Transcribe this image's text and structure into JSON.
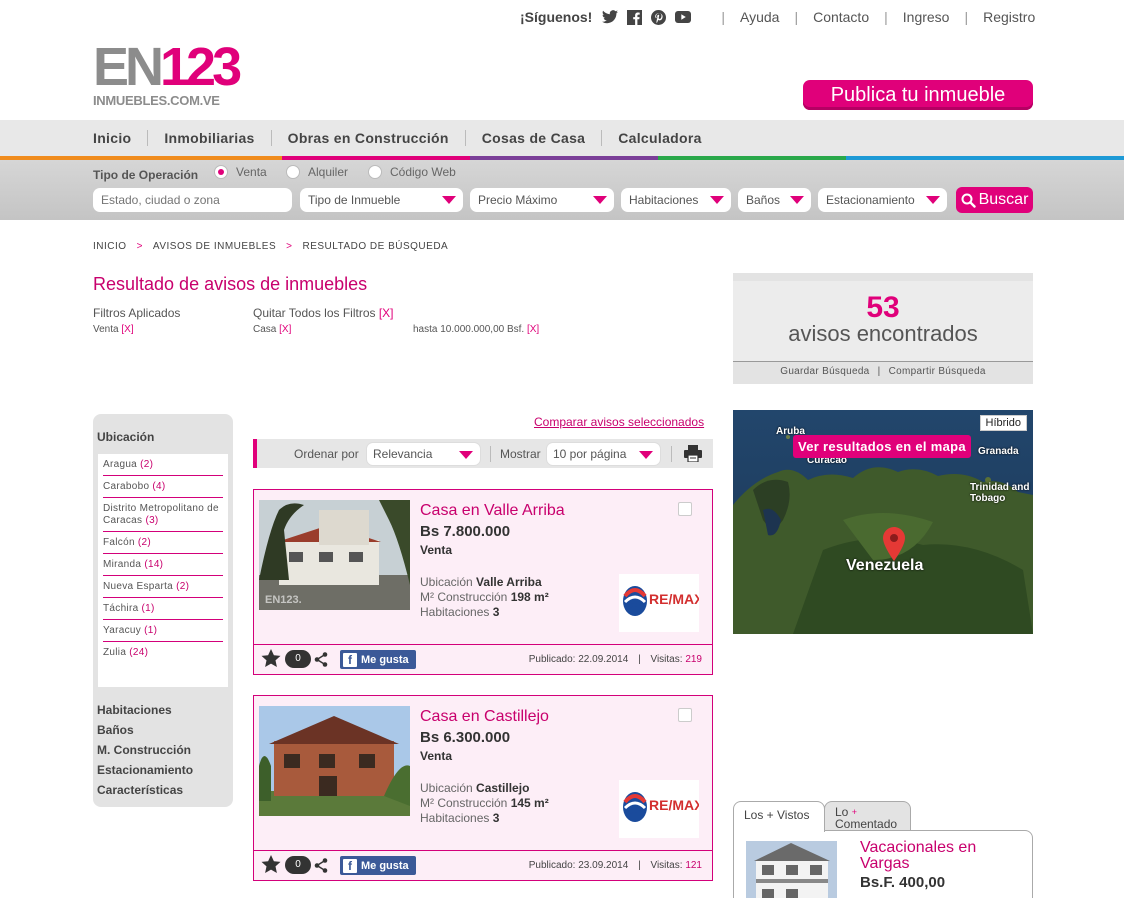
{
  "top": {
    "follow_label": "¡Síguenos!",
    "links": [
      "Ayuda",
      "Contacto",
      "Ingreso",
      "Registro"
    ]
  },
  "logo": {
    "main_en": "EN",
    "main_num": "123",
    "sub": "INMUEBLES.COM.VE"
  },
  "publish_button": "Publica tu inmueble",
  "nav": [
    "Inicio",
    "Inmobiliarias",
    "Obras en Construcción",
    "Cosas de Casa",
    "Calculadora"
  ],
  "colors": {
    "accent": "#e0007a",
    "stripe": [
      "#f08c1e",
      "#e0007a",
      "#7b3f98",
      "#29a84a",
      "#1e9ad6"
    ]
  },
  "search": {
    "operation_label": "Tipo de Operación",
    "operations": [
      {
        "label": "Venta",
        "selected": true
      },
      {
        "label": "Alquiler",
        "selected": false
      },
      {
        "label": "Código Web",
        "selected": false
      }
    ],
    "location_placeholder": "Estado, ciudad o zona",
    "selects": [
      "Tipo de Inmueble",
      "Precio Máximo",
      "Habitaciones",
      "Baños",
      "Estacionamiento"
    ],
    "button": "Buscar"
  },
  "breadcrumb": [
    "INICIO",
    "AVISOS DE INMUEBLES",
    "RESULTADO DE BÚSQUEDA"
  ],
  "results": {
    "title": "Resultado de avisos de inmuebles",
    "filters_label": "Filtros Aplicados",
    "remove_all": "Quitar Todos los Filtros",
    "remove_x": "[X]",
    "filters": [
      "Venta",
      "Casa",
      "hasta 10.000.000,00 Bsf."
    ]
  },
  "count": {
    "number": "53",
    "label": "avisos encontrados",
    "save": "Guardar Búsqueda",
    "share": "Compartir Búsqueda"
  },
  "map": {
    "hybrid": "Híbrido",
    "see_results": "Ver resultados en el mapa",
    "labels": [
      "Aruba",
      "Curacao",
      "Granada",
      "Trinidad and Tobago",
      "Venezuela"
    ]
  },
  "sidebar": {
    "location_title": "Ubicación",
    "locations": [
      {
        "name": "Aragua",
        "count": "(2)"
      },
      {
        "name": "Carabobo",
        "count": "(4)"
      },
      {
        "name": "Distrito Metropolitano de Caracas",
        "count": "(3)"
      },
      {
        "name": "Falcón",
        "count": "(2)"
      },
      {
        "name": "Miranda",
        "count": "(14)"
      },
      {
        "name": "Nueva Esparta",
        "count": "(2)"
      },
      {
        "name": "Táchira",
        "count": "(1)"
      },
      {
        "name": "Yaracuy",
        "count": "(1)"
      },
      {
        "name": "Zulia",
        "count": "(24)"
      }
    ],
    "other_filters": [
      "Habitaciones",
      "Baños",
      "M. Construcción",
      "Estacionamiento",
      "Características"
    ]
  },
  "compare_link": "Comparar avisos seleccionados",
  "sort": {
    "order_label": "Ordenar por",
    "order_value": "Relevancia",
    "show_label": "Mostrar",
    "show_value": "10 por página"
  },
  "listings": [
    {
      "title": "Casa en Valle Arriba",
      "price": "Bs 7.800.000",
      "operation": "Venta",
      "location_label": "Ubicación",
      "location": "Valle Arriba",
      "area_label": "M² Construcción",
      "area": "198 m²",
      "rooms_label": "Habitaciones",
      "rooms": "3",
      "comments": "0",
      "like": "Me gusta",
      "published_label": "Publicado:",
      "published": "22.09.2014",
      "visits_label": "Visitas:",
      "visits": "219",
      "agency": "RE/MAX V.I.P"
    },
    {
      "title": "Casa en Castillejo",
      "price": "Bs 6.300.000",
      "operation": "Venta",
      "location_label": "Ubicación",
      "location": "Castillejo",
      "area_label": "M² Construcción",
      "area": "145 m²",
      "rooms_label": "Habitaciones",
      "rooms": "3",
      "comments": "0",
      "like": "Me gusta",
      "published_label": "Publicado:",
      "published": "23.09.2014",
      "visits_label": "Visitas:",
      "visits": "121",
      "agency": "RE/MAX V.I.P"
    }
  ],
  "popular": {
    "tab_visited": "Los + Vistos",
    "tab_commented_a": "Lo",
    "tab_commented_b": "Comentado",
    "item_title": "Vacacionales en Vargas",
    "item_price": "Bs.F. 400,00"
  }
}
